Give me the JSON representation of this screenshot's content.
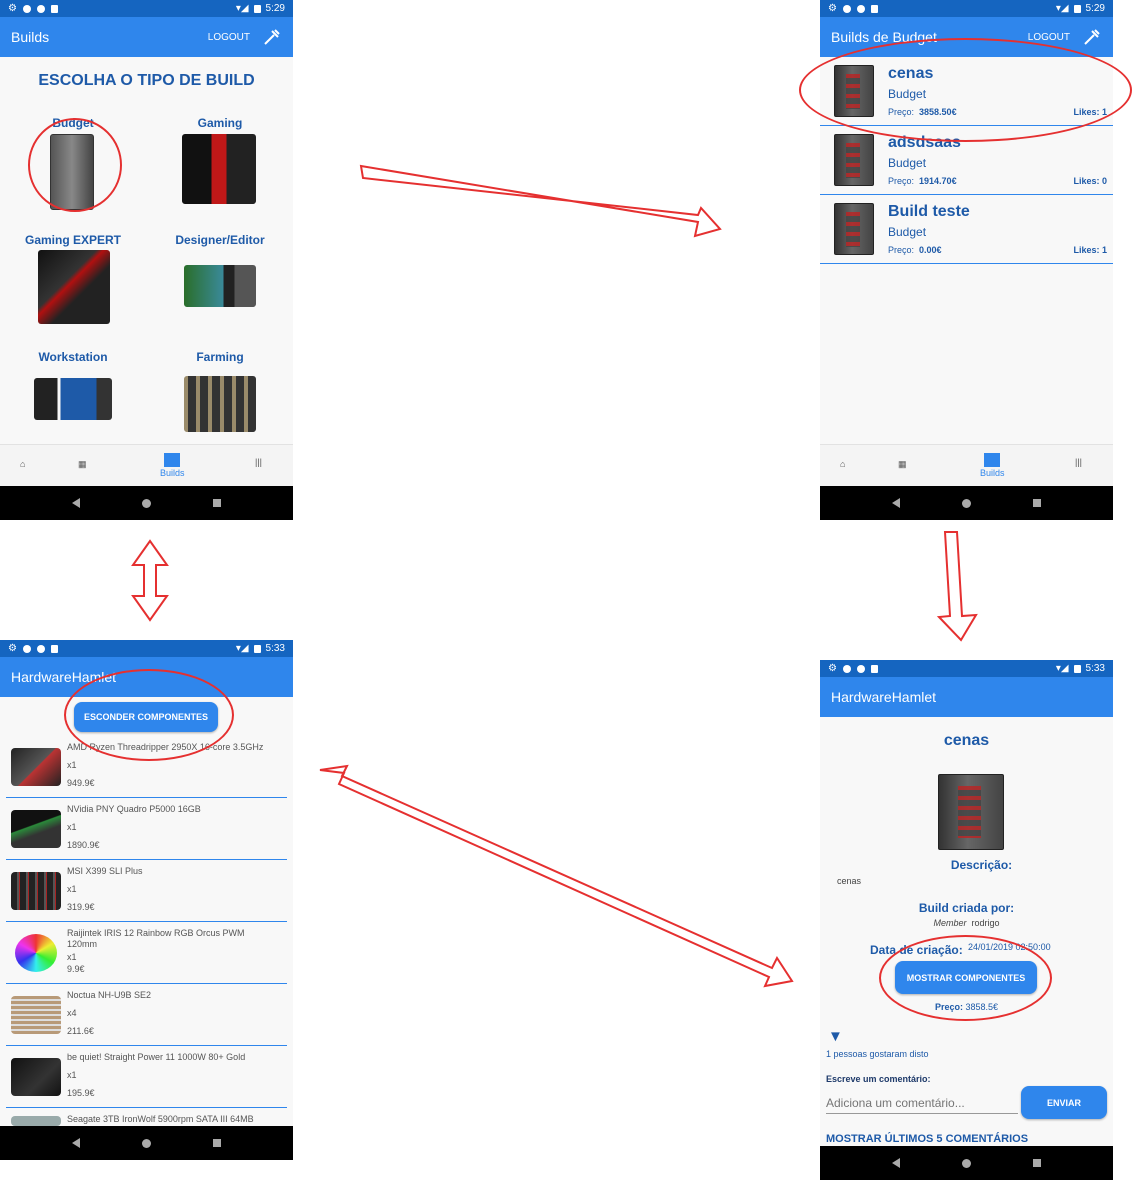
{
  "colors": {
    "primary": "#2f86ec",
    "heading": "#1e5aa8",
    "annotation": "#e53030",
    "statusbar": "#1565c0"
  },
  "screen1": {
    "status_time": "5:29",
    "title": "Builds",
    "logout": "LOGOUT",
    "heading": "ESCOLHA O TIPO DE BUILD",
    "categories": [
      {
        "label": "Budget",
        "icon": "tower-pc-icon"
      },
      {
        "label": "Gaming",
        "icon": "gaming-pc-icon"
      },
      {
        "label": "Gaming EXPERT",
        "icon": "expert-pc-icon"
      },
      {
        "label": "Designer/Editor",
        "icon": "designer-pc-icon"
      },
      {
        "label": "Workstation",
        "icon": "workstation-pc-icon"
      },
      {
        "label": "Farming",
        "icon": "mining-rig-icon"
      }
    ],
    "tabs": {
      "home": "home-icon",
      "gpu": "gpu-icon",
      "builds": "Builds",
      "stats": "stats-icon"
    }
  },
  "screen2": {
    "status_time": "5:29",
    "title": "Builds de Budget",
    "logout": "LOGOUT",
    "items": [
      {
        "name": "cenas",
        "type": "Budget",
        "price_label": "Preço:",
        "price": "3858.50€",
        "likes": "Likes: 1"
      },
      {
        "name": "adsdsaas",
        "type": "Budget",
        "price_label": "Preço:",
        "price": "1914.70€",
        "likes": "Likes: 0"
      },
      {
        "name": "Build teste",
        "type": "Budget",
        "price_label": "Preço:",
        "price": "0.00€",
        "likes": "Likes: 1"
      }
    ],
    "tabs": {
      "builds": "Builds"
    }
  },
  "screen3": {
    "status_time": "5:33",
    "title": "HardwareHamlet",
    "hide_button": "ESCONDER COMPONENTES",
    "components": [
      {
        "name": "AMD Ryzen Threadripper 2950X 16-core 3.5GHz",
        "qty": "x1",
        "price": "949.9€"
      },
      {
        "name": "NVidia PNY Quadro P5000 16GB",
        "qty": "x1",
        "price": "1890.9€"
      },
      {
        "name": "MSI X399 SLI Plus",
        "qty": "x1",
        "price": "319.9€"
      },
      {
        "name": "Raijintek IRIS 12 Rainbow RGB Orcus PWM 120mm",
        "qty": "x1",
        "price": "9.9€"
      },
      {
        "name": "Noctua NH-U9B SE2",
        "qty": "x4",
        "price": "211.6€"
      },
      {
        "name": "be quiet! Straight Power 11 1000W 80+ Gold",
        "qty": "x1",
        "price": "195.9€"
      },
      {
        "name": "Seagate 3TB IronWolf 5900rpm SATA III 64MB",
        "qty": "",
        "price": ""
      }
    ]
  },
  "screen4": {
    "status_time": "5:33",
    "title": "HardwareHamlet",
    "build_name": "cenas",
    "description_label": "Descrição:",
    "description": "cenas",
    "created_by_label": "Build criada por:",
    "member_label": "Member",
    "member_name": "rodrigo",
    "date_label": "Data de criação:",
    "date": "24/01/2019 02:50:00",
    "show_button": "MOSTRAR COMPONENTES",
    "price_label": "Preço:",
    "price": "3858.5€",
    "likes_text": "1 pessoas gostaram disto",
    "comment_label": "Escreve um comentário:",
    "comment_placeholder": "Adiciona um comentário...",
    "send_button": "ENVIAR",
    "last_comments": "MOSTRAR ÚLTIMOS 5 COMENTÁRIOS"
  }
}
